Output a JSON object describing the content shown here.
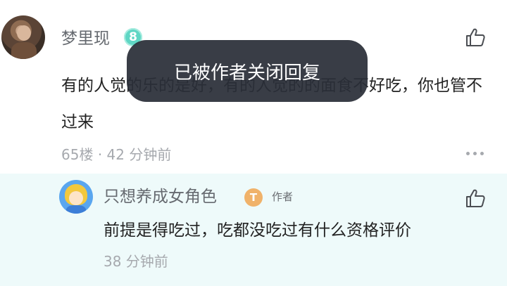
{
  "comment": {
    "author": "梦里现",
    "level_badge": "8",
    "text": "有的人觉的乐的是好，有的人觉的的面食不好吃，你也管不过来",
    "floor": "65楼",
    "separator": "·",
    "time": "42 分钟前"
  },
  "reply": {
    "author": "只想养成女角色",
    "level_badge": "T",
    "author_tag": "作者",
    "text": "前提是得吃过，吃都没吃过有什么资格评价",
    "time": "38 分钟前"
  },
  "toast": {
    "message": "已被作者关闭回复"
  },
  "colors": {
    "reply_background": "#eefafa",
    "toast_background": "#2a2e38",
    "level_badge_teal": "#5fd6c4",
    "level_badge_orange": "#f0b26a"
  }
}
